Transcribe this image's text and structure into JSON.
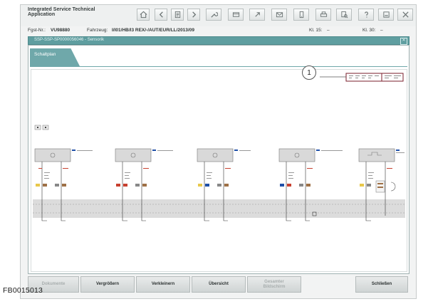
{
  "app": {
    "title": "Integrated Service Technical Application"
  },
  "infobar": {
    "fgst_label": "Fgst-Nr.:",
    "fgst_value": "VU98880",
    "vehicle_label": "Fahrzeug:",
    "vehicle_value": "I/I01/HB/I3 REX/-/AUT/EUR/LL/2013/09",
    "kl15_label": "Kl. 15:",
    "kl15_value": "–",
    "kl30_label": "Kl. 30:",
    "kl30_value": "–"
  },
  "toolbar": {
    "icons": [
      "home-icon",
      "back-icon",
      "document-icon",
      "forward-icon",
      "wrench-icon",
      "card-icon",
      "link-icon",
      "mail-icon",
      "phone-icon",
      "print-icon",
      "search-doc-icon",
      "help-icon",
      "minimize-icon",
      "close-icon"
    ]
  },
  "breadcrumb": {
    "path": "SSP-SSP-SP0000056046 - Sensorik"
  },
  "tabs": {
    "active": "Schaltplan"
  },
  "diagram": {
    "callout_number": "1",
    "modules": [
      "module-1",
      "module-2",
      "module-3",
      "module-4",
      "module-5"
    ]
  },
  "buttons": {
    "dokumente": "Dokumente",
    "vergroessern": "Vergrößern",
    "verkleinern": "Verkleinern",
    "uebersicht": "Übersicht",
    "gesamte_bildschirm_line1": "Gesamter",
    "gesamte_bildschirm_line2": "Bildschirm",
    "schliessen": "Schließen"
  },
  "figure_id": "FB0015013"
}
